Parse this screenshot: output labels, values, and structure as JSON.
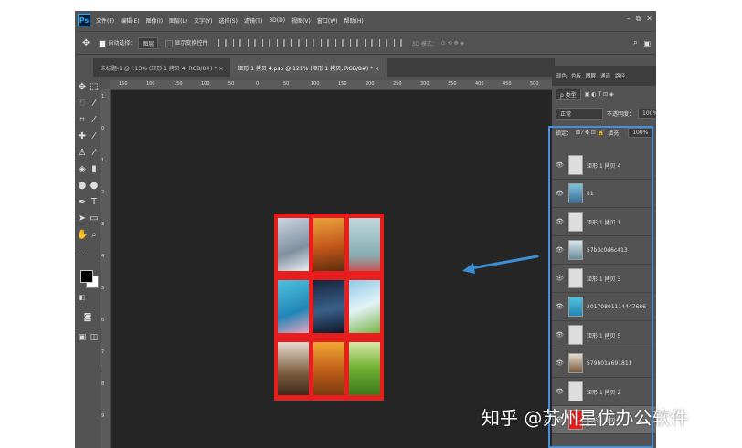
{
  "app": {
    "logo_text": "Ps"
  },
  "menubar": {
    "items": [
      "文件(F)",
      "编辑(E)",
      "图像(I)",
      "图层(L)",
      "文字(Y)",
      "选择(S)",
      "滤镜(T)",
      "3D(D)",
      "视图(V)",
      "窗口(W)",
      "帮助(H)"
    ],
    "window_controls": [
      "–",
      "⧉",
      "✕"
    ]
  },
  "options_bar": {
    "move_icon": "move-icon",
    "auto_select_label": "自动选择：",
    "auto_select_value": "图层",
    "show_transform_label": "显示变换控件",
    "mode_3d_label": "3D 模式："
  },
  "tabs": [
    {
      "label": "未标题-1 @ 113% (矩形 1 拷贝 4, RGB/8#) * ×",
      "active": false
    },
    {
      "label": "矩形 1 拷贝 4.psb @ 121% (矩形 1 拷贝, RGB/8#) * ×",
      "active": true
    }
  ],
  "ruler": {
    "h_ticks": [
      "150",
      "100",
      "150",
      "100",
      "50",
      "0",
      "50",
      "100",
      "150",
      "200",
      "250",
      "300",
      "350",
      "400",
      "450",
      "500"
    ],
    "v_ticks": [
      "1",
      "0",
      "1",
      "2",
      "3",
      "4",
      "5",
      "6",
      "7",
      "8",
      "9"
    ]
  },
  "toolbox": {
    "tools": [
      "move-icon",
      "marquee-icon",
      "lasso-icon",
      "magic-wand-icon",
      "crop-icon",
      "eyedropper-icon",
      "healing-brush-icon",
      "brush-icon",
      "clone-stamp-icon",
      "history-brush-icon",
      "eraser-icon",
      "gradient-icon",
      "blur-icon",
      "dodge-icon",
      "pen-icon",
      "text-icon",
      "path-selection-icon",
      "shape-icon",
      "hand-icon",
      "zoom-icon"
    ],
    "foreground_color": "#000000",
    "background_color": "#ffffff"
  },
  "panels": {
    "tabs": [
      "颜色",
      "色板",
      "图层",
      "通道",
      "路径"
    ],
    "active_tab": "图层",
    "filter_label": "ρ 类型",
    "blend_mode": "正常",
    "opacity_label": "不透明度：",
    "opacity_value": "100%",
    "lock_label": "锁定：",
    "fill_label": "填充：",
    "fill_value": "100%"
  },
  "layers": [
    {
      "name": "矩形 1 拷贝 4"
    },
    {
      "name": "01"
    },
    {
      "name": "矩形 1 拷贝 1"
    },
    {
      "name": "57b3c0d6c413"
    },
    {
      "name": "矩形 1 拷贝 3"
    },
    {
      "name": "20170801114447686"
    },
    {
      "name": "矩形 1 拷贝 5"
    },
    {
      "name": "579b01a691811"
    },
    {
      "name": "矩形 1 拷贝 2"
    },
    {
      "name": "矩形 1 拷贝"
    }
  ],
  "canvas": {
    "background": "#262626",
    "document_fill": "#e61e1e"
  },
  "annotation": {
    "arrow_color": "#3b8fd6",
    "highlight_color": "#4a90d9"
  },
  "watermark": "知乎 @苏州星优办公软件"
}
